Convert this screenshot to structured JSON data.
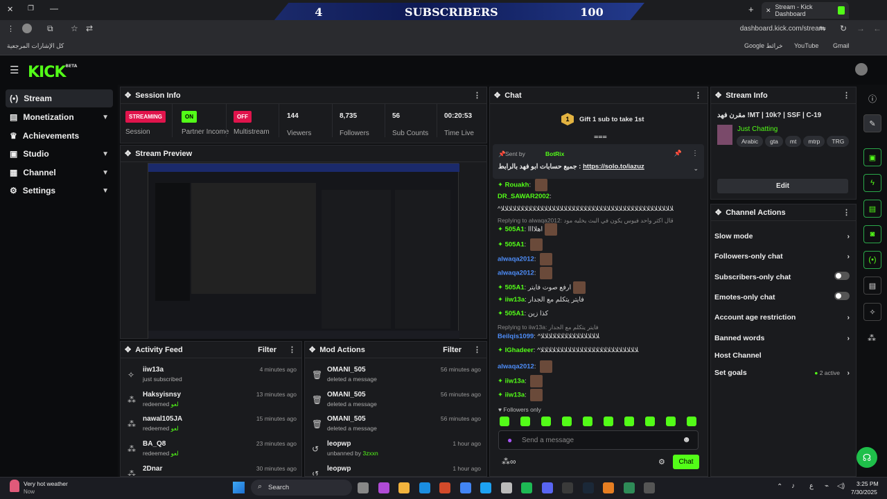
{
  "browser": {
    "tab_title": "Stream - Kick Dashboard",
    "url": "dashboard.kick.com/stream",
    "bookmarks_all": "كل الإشارات المرجعية",
    "bookmarks": [
      "Google خرائط",
      "YouTube",
      "Gmail"
    ]
  },
  "banner": {
    "left": "4",
    "mid": "SUBSCRIBERS",
    "right": "100"
  },
  "brand": {
    "logo": "KICK",
    "sup": "BETA"
  },
  "sidebar": {
    "items": [
      {
        "label": "Stream",
        "icon": "broadcast-icon"
      },
      {
        "label": "Monetization",
        "icon": "money-icon"
      },
      {
        "label": "Achievements",
        "icon": "trophy-icon"
      },
      {
        "label": "Studio",
        "icon": "studio-icon"
      },
      {
        "label": "Channel",
        "icon": "channel-icon"
      },
      {
        "label": "Settings",
        "icon": "gear-icon"
      }
    ]
  },
  "session": {
    "title": "Session Info",
    "stats": [
      {
        "badge": "STREAMING",
        "label": "Session"
      },
      {
        "badge": "ON",
        "label": "Partner Income"
      },
      {
        "badge": "OFF",
        "label": "Multistream"
      },
      {
        "value": "144",
        "label": "Viewers"
      },
      {
        "value": "8,735",
        "label": "Followers"
      },
      {
        "value": "56",
        "label": "Sub Counts"
      },
      {
        "value": "00:20:53",
        "label": "Time Live"
      }
    ]
  },
  "preview": {
    "title": "Stream Preview"
  },
  "activity": {
    "title": "Activity Feed",
    "filter": "Filter",
    "rows": [
      {
        "user": "iiw13a",
        "desc": "just subscribed",
        "time": "4 minutes ago"
      },
      {
        "user": "Haksyisnsy",
        "desc": "redeemed",
        "reward": "لعو",
        "time": "13 minutes ago"
      },
      {
        "user": "nawal105JA",
        "desc": "redeemed",
        "reward": "لعو",
        "time": "15 minutes ago"
      },
      {
        "user": "BA_Q8",
        "desc": "redeemed",
        "reward": "لعو",
        "time": "23 minutes ago"
      },
      {
        "user": "2Dnar",
        "desc": "",
        "time": "30 minutes ago"
      }
    ]
  },
  "mod": {
    "title": "Mod Actions",
    "filter": "Filter",
    "rows": [
      {
        "user": "OMANI_505",
        "desc": "deleted a message",
        "time": "56 minutes ago"
      },
      {
        "user": "OMANI_505",
        "desc": "deleted a message",
        "time": "56 minutes ago"
      },
      {
        "user": "OMANI_505",
        "desc": "deleted a message",
        "time": "56 minutes ago"
      },
      {
        "user": "leopwp",
        "desc": "unbanned by",
        "by": "3zxxn",
        "time": "1 hour ago"
      },
      {
        "user": "leopwp",
        "desc": "",
        "time": "1 hour ago"
      }
    ]
  },
  "chat": {
    "title": "Chat",
    "gift": "Gift 1 sub to take 1st",
    "gift_count": "1",
    "pinned_by": "Sent by",
    "pinned_user": "BotRix",
    "pinned_msg": "جميع حسابات ابو فهد بالرابط : ",
    "pinned_link": "https://solo.to/iazuz",
    "lines": [
      {
        "name": "Rouakh",
        "color": "g",
        "badge": true,
        "text": "",
        "emote": true
      },
      {
        "name": "DR_SAWAR2002",
        "color": "g",
        "badge": false,
        "text": ""
      },
      {
        "name": "",
        "color": "",
        "badge": false,
        "text": "^ﻼﻼﻼﻼﻼﻼﻼﻼﻼﻼﻼﻼﻼﻼﻼﻼﻼﻼﻼﻼﻼﻼﻼﻼﻼﻼﻼﻼﻼﻼﻼﻼﻼﻼﻼﻼﻼﻼﻼﻼﻼﻼﻼﻼ"
      },
      {
        "reply": "Replying to alwaqa2012: قال اكثر واحد فيوس يكون في البث يخليه مود"
      },
      {
        "name": "505A1",
        "color": "g",
        "badge": true,
        "text": "اهلاااا",
        "emote": true
      },
      {
        "name": "505A1",
        "color": "g",
        "badge": true,
        "text": "",
        "emote": true
      },
      {
        "name": "alwaqa2012",
        "color": "b",
        "badge": false,
        "text": "",
        "emote": true
      },
      {
        "name": "alwaqa2012",
        "color": "b",
        "badge": false,
        "text": "",
        "emote": true
      },
      {
        "name": "505A1",
        "color": "g",
        "badge": true,
        "text": "ارفع صوت فايتر",
        "emote": true
      },
      {
        "name": "iiw13a",
        "color": "g",
        "badge": true,
        "text": "فايتر يتكلم مع الجدار"
      },
      {
        "name": "505A1",
        "color": "g",
        "badge": true,
        "text": "كذا زين"
      },
      {
        "reply": "Replying to iiw13a: فايتر يتكلم مع الجدار"
      },
      {
        "name": "Beilqis1099",
        "color": "b",
        "badge": false,
        "text": "^ﻼﻼﻼﻼﻼﻼﻼﻼﻼﻼﻼﻼﻼﻼﻼ"
      },
      {
        "name": "IGhadeer",
        "color": "g",
        "badge": true,
        "text": "^ﻼﻼﻼﻼﻼﻼﻼﻼﻼﻼﻼﻼﻼﻼﻼﻼﻼﻼﻼﻼﻼﻼﻼﻼﻼ"
      },
      {
        "name": "alwaqa2012",
        "color": "b",
        "badge": false,
        "text": "",
        "emote": true
      },
      {
        "name": "iiw13a",
        "color": "g",
        "badge": true,
        "text": "",
        "emote": true
      },
      {
        "name": "iiw13a",
        "color": "g",
        "badge": true,
        "text": "",
        "emote": true
      }
    ],
    "followers_only": "Followers only",
    "placeholder": "Send a message",
    "send": "Chat"
  },
  "streaminfo": {
    "title": "Stream Info",
    "stream_title": "مقرن فهد !MT | 10k? | SSF | C-19",
    "category": "Just Chatting",
    "tags": [
      "Arabic",
      "gta",
      "mt",
      "mtrp",
      "TRG"
    ],
    "edit": "Edit"
  },
  "actions": {
    "title": "Channel Actions",
    "items": [
      {
        "label": "Slow mode",
        "kind": "arrow"
      },
      {
        "label": "Followers-only chat",
        "kind": "arrow"
      },
      {
        "label": "Subscribers-only chat",
        "kind": "toggle"
      },
      {
        "label": "Emotes-only chat",
        "kind": "toggle"
      },
      {
        "label": "Account age restriction",
        "kind": "arrow"
      },
      {
        "label": "Banned words",
        "kind": "arrow"
      },
      {
        "label": "Host Channel",
        "kind": "none"
      },
      {
        "label": "Set goals",
        "kind": "arrow",
        "extra": "2 active"
      }
    ]
  },
  "taskbar": {
    "weather_title": "Very hot weather",
    "weather_sub": "Now",
    "search": "Search",
    "time": "3:25 PM",
    "date": "7/30/2025",
    "lang": "ع"
  },
  "colors": {
    "accent": "#53fc18",
    "streaming": "#e0144c",
    "panel": "#1a1b1e"
  }
}
